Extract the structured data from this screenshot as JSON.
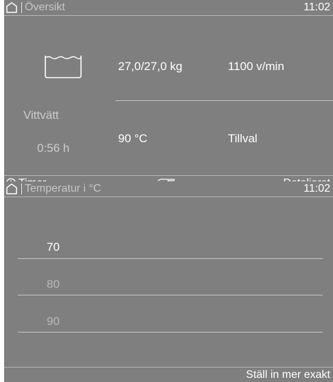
{
  "overview": {
    "header": {
      "title": "Översikt",
      "time": "11:02",
      "home_icon": "home-icon"
    },
    "program_icon": "wash-tub-icon",
    "load": "27,0/27,0 kg",
    "spin": "1100 v/min",
    "program_name": "Vittvätt",
    "duration": "0:56 h",
    "temperature": "90 °C",
    "extras": "Tillval",
    "footer": {
      "timer_label": "Timer",
      "timer_icon": "clock-icon",
      "hand_icon": "pointing-hand-icon",
      "details_label": "Detaljerat"
    }
  },
  "temperature_menu": {
    "header": {
      "title": "Temperatur i °C",
      "time": "11:02",
      "home_icon": "home-icon"
    },
    "options": [
      "70",
      "80",
      "90"
    ],
    "selected": "70",
    "footer": {
      "action_label": "Ställ in mer exakt"
    }
  }
}
